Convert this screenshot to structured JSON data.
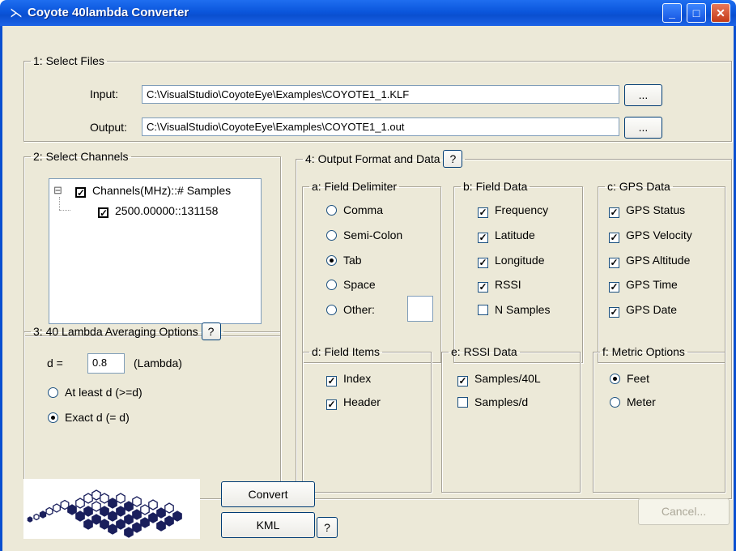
{
  "window": {
    "title": "Coyote 40lambda Converter",
    "icon": "lambda-icon",
    "minimize": "_",
    "maximize": "□",
    "close": "✕"
  },
  "files": {
    "legend": "1: Select Files",
    "input_label": "Input:",
    "input_value": "C:\\VisualStudio\\CoyoteEye\\Examples\\COYOTE1_1.KLF",
    "output_label": "Output:",
    "output_value": "C:\\VisualStudio\\CoyoteEye\\Examples\\COYOTE1_1.out",
    "browse_label": "..."
  },
  "channels": {
    "legend": "2: Select Channels",
    "expander": "⊟",
    "root_label": "Channels(MHz)::# Samples",
    "child_label": "2500.00000::131158",
    "root_checked": true,
    "child_checked": true
  },
  "averaging": {
    "legend": "3: 40 Lambda Averaging Options",
    "help": "?",
    "d_label": "d =",
    "d_value": "0.8",
    "d_unit": "(Lambda)",
    "options": [
      {
        "label": "At least d (>=d)",
        "selected": false
      },
      {
        "label": "Exact d (= d)",
        "selected": true
      }
    ]
  },
  "output_format": {
    "legend": "4: Output Format and Data",
    "help": "?",
    "delimiter": {
      "legend": "a: Field Delimiter",
      "options": [
        {
          "label": "Comma",
          "selected": false
        },
        {
          "label": "Semi-Colon",
          "selected": false
        },
        {
          "label": "Tab",
          "selected": true
        },
        {
          "label": "Space",
          "selected": false
        },
        {
          "label": "Other:",
          "selected": false
        }
      ],
      "other_value": ""
    },
    "field_data": {
      "legend": "b: Field Data",
      "items": [
        {
          "label": "Frequency",
          "checked": true
        },
        {
          "label": "Latitude",
          "checked": true
        },
        {
          "label": "Longitude",
          "checked": true
        },
        {
          "label": "RSSI",
          "checked": true
        },
        {
          "label": "N Samples",
          "checked": false
        }
      ]
    },
    "gps_data": {
      "legend": "c: GPS Data",
      "items": [
        {
          "label": "GPS Status",
          "checked": true
        },
        {
          "label": "GPS Velocity",
          "checked": true
        },
        {
          "label": "GPS Altitude",
          "checked": true
        },
        {
          "label": "GPS Time",
          "checked": true
        },
        {
          "label": "GPS Date",
          "checked": true
        }
      ]
    },
    "field_items": {
      "legend": "d: Field Items",
      "items": [
        {
          "label": "Index",
          "checked": true
        },
        {
          "label": "Header",
          "checked": true
        }
      ]
    },
    "rssi_data": {
      "legend": "e: RSSI Data",
      "items": [
        {
          "label": "Samples/40L",
          "checked": true
        },
        {
          "label": "Samples/d",
          "checked": false
        }
      ]
    },
    "metric": {
      "legend": "f: Metric Options",
      "options": [
        {
          "label": "Feet",
          "selected": true
        },
        {
          "label": "Meter",
          "selected": false
        }
      ]
    }
  },
  "actions": {
    "convert": "Convert",
    "kml": "KML",
    "kml_help": "?",
    "cancel": "Cancel..."
  },
  "logo": {
    "icon": "hexagon-logo-icon"
  },
  "colors": {
    "titlebar": "#0a4fd0",
    "dialog_bg": "#ece9d8",
    "logo_fill": "#1a1f5c"
  }
}
